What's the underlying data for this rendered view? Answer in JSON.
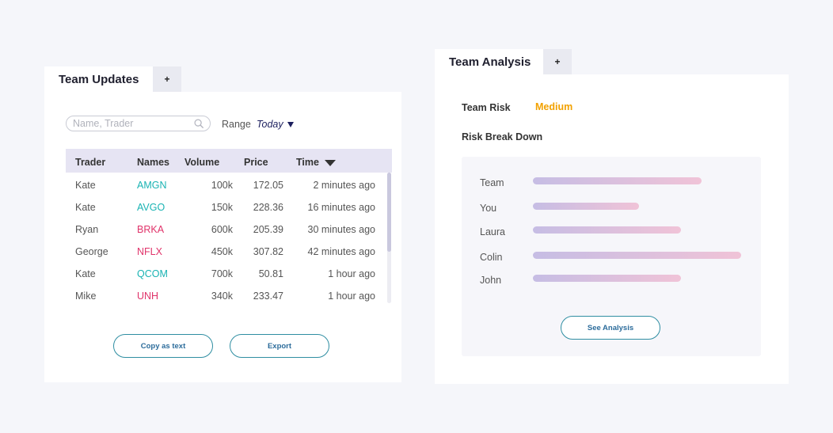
{
  "updates": {
    "tab_title": "Team Updates",
    "add_tab_label": "+",
    "search_placeholder": "Name, Trader",
    "range_label": "Range",
    "range_value": "Today",
    "columns": [
      "Trader",
      "Names",
      "Volume",
      "Price",
      "Time"
    ],
    "rows": [
      {
        "trader": "Kate",
        "name": "AMGN",
        "name_color": "#19b3b3",
        "volume": "100k",
        "price": "172.05",
        "time": "2 minutes ago"
      },
      {
        "trader": "Kate",
        "name": "AVGO",
        "name_color": "#19b3b3",
        "volume": "150k",
        "price": "228.36",
        "time": "16 minutes ago"
      },
      {
        "trader": "Ryan",
        "name": "BRKA",
        "name_color": "#e0336a",
        "volume": "600k",
        "price": "205.39",
        "time": "30 minutes ago"
      },
      {
        "trader": "George",
        "name": "NFLX",
        "name_color": "#e0336a",
        "volume": "450k",
        "price": "307.82",
        "time": "42 minutes ago"
      },
      {
        "trader": "Kate",
        "name": "QCOM",
        "name_color": "#19b3b3",
        "volume": "700k",
        "price": "50.81",
        "time": "1 hour ago"
      },
      {
        "trader": "Mike",
        "name": "UNH",
        "name_color": "#e0336a",
        "volume": "340k",
        "price": "233.47",
        "time": "1 hour ago"
      }
    ],
    "copy_button": "Copy as text",
    "export_button": "Export"
  },
  "analysis": {
    "tab_title": "Team Analysis",
    "add_tab_label": "+",
    "risk_label": "Team Risk",
    "risk_value": "Medium",
    "risk_color": "#f2a100",
    "breakdown_label": "Risk Break Down",
    "breakdown": [
      {
        "name": "Team",
        "level": 0.81
      },
      {
        "name": "You",
        "level": 0.51
      },
      {
        "name": "Laura",
        "level": 0.71
      },
      {
        "name": "Colin",
        "level": 1.0
      },
      {
        "name": "John",
        "level": 0.71
      }
    ],
    "see_analysis_button": "See Analysis"
  }
}
